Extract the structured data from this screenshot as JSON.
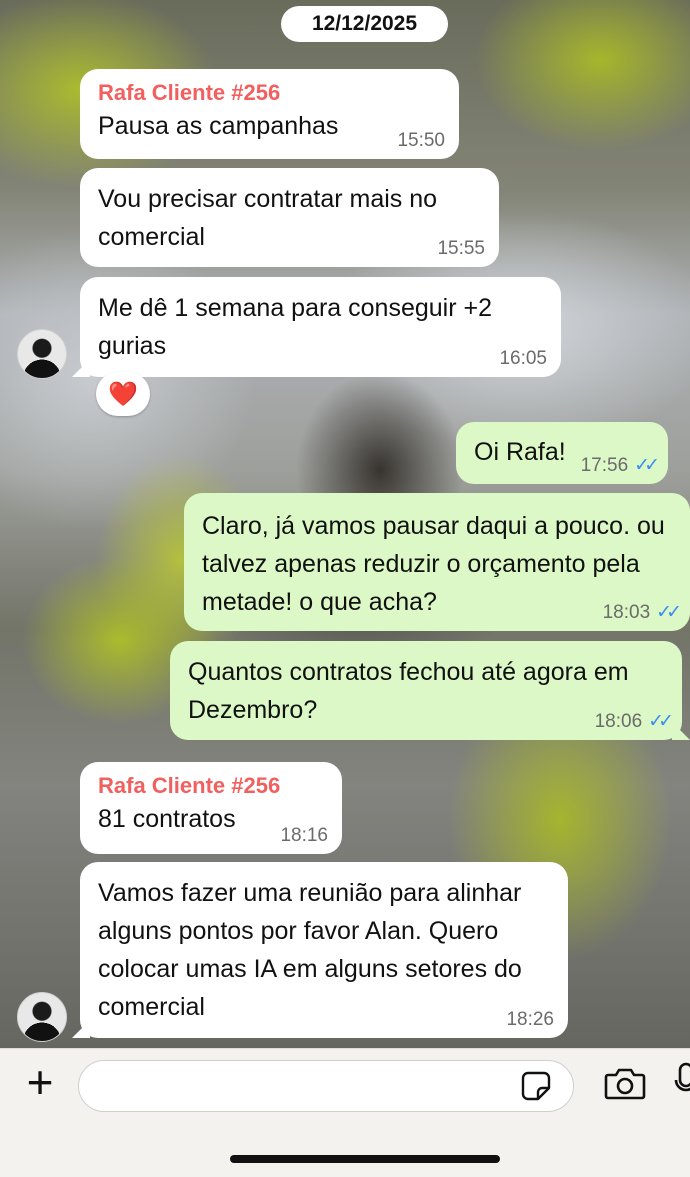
{
  "chat": {
    "date": "12/12/2025",
    "messages": [
      {
        "direction": "in",
        "sender": "Rafa Cliente #256",
        "text": "Pausa as campanhas",
        "time": "15:50"
      },
      {
        "direction": "in",
        "text": "Vou precisar contratar mais no comercial",
        "time": "15:55"
      },
      {
        "direction": "in",
        "text": "Me dê 1 semana para conseguir +2 gurias",
        "time": "16:05",
        "reaction": "❤️"
      },
      {
        "direction": "out",
        "text": "Oi Rafa!",
        "time": "17:56",
        "status": "read"
      },
      {
        "direction": "out",
        "text": "Claro, já vamos pausar daqui a pouco. ou talvez apenas reduzir o orçamento pela metade! o que acha?",
        "time": "18:03",
        "status": "read"
      },
      {
        "direction": "out",
        "text": "Quantos contratos fechou até agora em Dezembro?",
        "time": "18:06",
        "status": "read"
      },
      {
        "direction": "in",
        "sender": "Rafa Cliente #256",
        "text": "81 contratos",
        "time": "18:16"
      },
      {
        "direction": "in",
        "text": "Vamos fazer uma reunião para alinhar alguns pontos por favor Alan. Quero colocar umas IA em alguns setores do comercial",
        "time": "18:26"
      }
    ]
  },
  "composer": {
    "placeholder": "",
    "icons": [
      "plus-icon",
      "sticker-icon",
      "camera-icon",
      "microphone-icon"
    ]
  },
  "colors": {
    "incoming_bubble": "#ffffff",
    "outgoing_bubble": "#dcf8c6",
    "sender_name": "#f25f5f",
    "read_ticks": "#3a8df5"
  }
}
